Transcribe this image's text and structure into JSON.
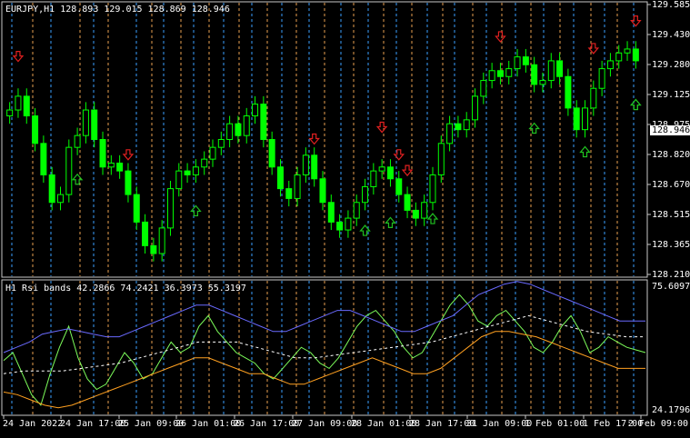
{
  "main": {
    "title": "EURJPY,H1  128.893 129.015 128.869 128.946",
    "current_price": "128.946",
    "y_ticks": [
      "129.585",
      "129.430",
      "129.280",
      "129.125",
      "128.975",
      "128.820",
      "128.670",
      "128.515",
      "128.365",
      "128.210"
    ]
  },
  "sub": {
    "title": "H1 Rsi bands 42.2866 74.2421 36.3973 55.3197",
    "y_ticks": [
      "75.6097",
      "24.1796"
    ]
  },
  "x_ticks": [
    "24 Jan 2022",
    "24 Jan 17:00",
    "25 Jan 09:00",
    "26 Jan 01:00",
    "26 Jan 17:00",
    "27 Jan 09:00",
    "28 Jan 01:00",
    "28 Jan 17:00",
    "31 Jan 09:00",
    "1 Feb 01:00",
    "1 Feb 17:00",
    "2 Feb 09:00"
  ],
  "colors": {
    "candle": "#00ff00",
    "grid_orange": "#e8a050",
    "grid_blue": "#3aa0ff",
    "sell_arrow": "#e02020",
    "buy_arrow": "#20c020",
    "rsi": "#7cfc5a",
    "upper_band": "#6a6aff",
    "lower_band": "#ffa020",
    "mid_band": "#ffffff"
  },
  "chart_data": [
    {
      "type": "candlestick",
      "title": "EURJPY,H1",
      "ylim": [
        128.2,
        129.6
      ],
      "close": [
        129.05,
        129.12,
        129.02,
        128.88,
        128.72,
        128.58,
        128.62,
        128.86,
        128.92,
        129.05,
        128.9,
        128.76,
        128.78,
        128.74,
        128.62,
        128.48,
        128.36,
        128.32,
        128.45,
        128.65,
        128.74,
        128.72,
        128.76,
        128.8,
        128.86,
        128.9,
        128.98,
        128.92,
        129.02,
        129.08,
        128.9,
        128.76,
        128.65,
        128.6,
        128.72,
        128.82,
        128.7,
        128.58,
        128.48,
        128.44,
        128.5,
        128.58,
        128.66,
        128.74,
        128.76,
        128.7,
        128.62,
        128.54,
        128.5,
        128.58,
        128.72,
        128.88,
        128.98,
        128.95,
        129.0,
        129.12,
        129.2,
        129.25,
        129.22,
        129.26,
        129.32,
        129.28,
        129.18,
        129.2,
        129.3,
        129.22,
        129.06,
        128.95,
        129.06,
        129.16,
        129.26,
        129.3,
        129.34,
        129.36,
        129.3
      ],
      "x_categories": [
        "24 Jan 2022",
        "24 Jan 17:00",
        "25 Jan 09:00",
        "26 Jan 01:00",
        "26 Jan 17:00",
        "27 Jan 09:00",
        "28 Jan 01:00",
        "28 Jan 17:00",
        "31 Jan 09:00",
        "1 Feb 01:00",
        "1 Feb 17:00",
        "2 Feb 09:00"
      ],
      "sell_signal_indices": [
        1,
        14,
        36,
        44,
        46,
        47,
        58,
        69,
        79
      ],
      "buy_signal_indices": [
        8,
        22,
        42,
        45,
        50,
        62,
        68,
        77,
        83
      ]
    },
    {
      "type": "line",
      "title": "H1 Rsi bands",
      "ylim": [
        24.1796,
        75.6097
      ],
      "series": [
        {
          "name": "",
          "values": [
            45,
            48,
            40,
            32,
            28,
            40,
            50,
            58,
            46,
            38,
            34,
            36,
            42,
            48,
            44,
            38,
            40,
            46,
            52,
            48,
            50,
            58,
            62,
            56,
            52,
            48,
            46,
            44,
            40,
            38,
            42,
            46,
            50,
            48,
            44,
            42,
            46,
            52,
            58,
            62,
            64,
            60,
            56,
            50,
            46,
            48,
            54,
            60,
            66,
            70,
            66,
            60,
            58,
            62,
            64,
            60,
            56,
            50,
            48,
            52,
            58,
            62,
            56,
            48,
            50,
            54,
            52,
            50,
            49,
            48
          ]
        },
        {
          "name": "",
          "values": [
            48,
            50,
            52,
            55,
            56,
            57,
            56,
            55,
            54,
            54,
            56,
            58,
            60,
            62,
            64,
            66,
            66,
            64,
            62,
            60,
            58,
            56,
            56,
            58,
            60,
            62,
            64,
            64,
            62,
            60,
            58,
            56,
            56,
            58,
            60,
            62,
            66,
            70,
            72,
            74,
            75,
            74,
            72,
            70,
            68,
            66,
            64,
            62,
            60,
            60,
            60
          ]
        },
        {
          "name": "",
          "values": [
            33,
            32,
            30,
            28,
            27,
            28,
            30,
            32,
            34,
            36,
            38,
            40,
            42,
            44,
            46,
            46,
            44,
            42,
            40,
            40,
            38,
            36,
            36,
            38,
            40,
            42,
            44,
            46,
            44,
            42,
            40,
            40,
            42,
            46,
            50,
            54,
            56,
            56,
            55,
            54,
            52,
            50,
            48,
            46,
            44,
            42,
            42,
            42
          ]
        },
        {
          "name": "",
          "values": [
            40,
            41,
            41,
            41,
            42,
            43,
            44,
            46,
            48,
            50,
            52,
            52,
            52,
            50,
            48,
            46,
            46,
            47,
            48,
            49,
            50,
            51,
            52,
            54,
            56,
            58,
            60,
            62,
            60,
            58,
            56,
            55,
            54,
            54
          ]
        }
      ]
    }
  ]
}
